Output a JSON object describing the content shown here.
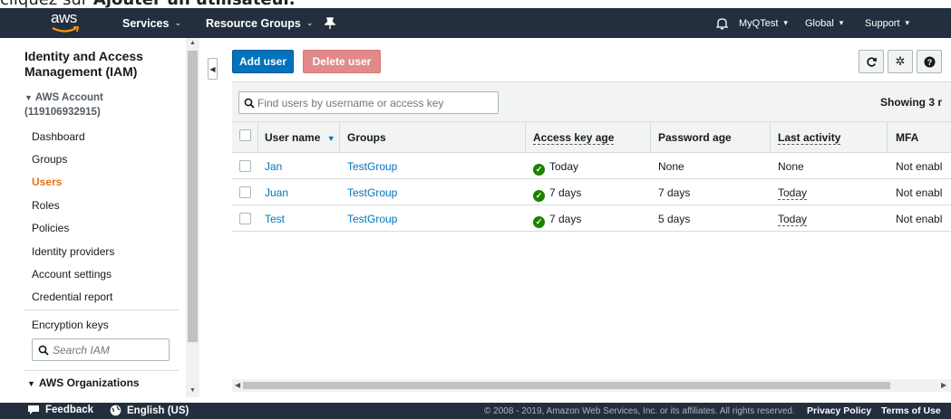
{
  "caption": {
    "prefix": "cliquez sur ",
    "bold": "Ajouter un utilisateur."
  },
  "topnav": {
    "logo": "aws",
    "services": "Services",
    "resource_groups": "Resource Groups",
    "account": "MyQTest",
    "region": "Global",
    "support": "Support"
  },
  "sidebar": {
    "title_line1": "Identity and Access",
    "title_line2": "Management (IAM)",
    "account_label": "AWS Account",
    "account_id": "(119106932915)",
    "items": [
      {
        "label": "Dashboard",
        "active": false
      },
      {
        "label": "Groups",
        "active": false
      },
      {
        "label": "Users",
        "active": true
      },
      {
        "label": "Roles",
        "active": false
      },
      {
        "label": "Policies",
        "active": false
      },
      {
        "label": "Identity providers",
        "active": false
      },
      {
        "label": "Account settings",
        "active": false
      },
      {
        "label": "Credential report",
        "active": false
      }
    ],
    "encryption": "Encryption keys",
    "search_placeholder": "Search IAM",
    "organizations": "AWS Organizations"
  },
  "toolbar": {
    "add_user": "Add user",
    "delete_user": "Delete user"
  },
  "table": {
    "search_placeholder": "Find users by username or access key",
    "showing": "Showing 3 r",
    "headers": {
      "username": "User name",
      "groups": "Groups",
      "access_key_age": "Access key age",
      "password_age": "Password age",
      "last_activity": "Last activity",
      "mfa": "MFA"
    },
    "rows": [
      {
        "username": "Jan",
        "groups": "TestGroup",
        "access_key_age": "Today",
        "password_age": "None",
        "last_activity": "None",
        "mfa": "Not enabl"
      },
      {
        "username": "Juan",
        "groups": "TestGroup",
        "access_key_age": "7 days",
        "password_age": "7 days",
        "last_activity": "Today",
        "mfa": "Not enabl"
      },
      {
        "username": "Test",
        "groups": "TestGroup",
        "access_key_age": "7 days",
        "password_age": "5 days",
        "last_activity": "Today",
        "mfa": "Not enabl"
      }
    ]
  },
  "footer": {
    "feedback": "Feedback",
    "language": "English (US)",
    "copyright": "© 2008 - 2019, Amazon Web Services, Inc. or its affiliates. All rights reserved.",
    "privacy": "Privacy Policy",
    "terms": "Terms of Use"
  },
  "colors": {
    "nav_bg": "#232f3e",
    "primary_button": "#0073bb",
    "delete_button": "#e08a8a",
    "active_nav": "#ec7211",
    "link": "#0073bb",
    "success": "#1d8102"
  },
  "icons": {
    "refresh": "refresh-icon",
    "settings": "gear-icon",
    "help": "help-icon",
    "bell": "bell-icon",
    "pin": "pin-icon",
    "search": "search-icon"
  }
}
